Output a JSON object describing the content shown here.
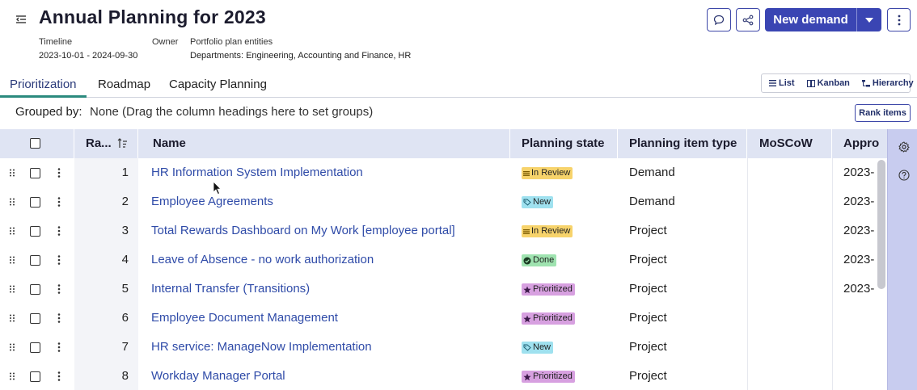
{
  "header": {
    "title": "Annual Planning for 2023",
    "timeline_label": "Timeline",
    "timeline_value": "2023-10-01 - 2024-09-30",
    "owner_label": "Owner",
    "entities_label": "Portfolio plan entities",
    "entities_value": "Departments: Engineering, Accounting and Finance, HR",
    "new_demand_label": "New demand",
    "icons": [
      "collapse-icon",
      "comment-icon",
      "share-icon",
      "chevron-down-icon",
      "more-vertical-icon"
    ]
  },
  "tabs": [
    {
      "label": "Prioritization",
      "active": true
    },
    {
      "label": "Roadmap",
      "active": false
    },
    {
      "label": "Capacity Planning",
      "active": false
    }
  ],
  "view_switch": {
    "list": "List",
    "kanban": "Kanban",
    "hierarchy": "Hierarchy"
  },
  "grouping": {
    "label": "Grouped by:",
    "value": "None (Drag the column headings here to set groups)",
    "rank_button": "Rank items"
  },
  "columns": {
    "rank": "Ra...",
    "name": "Name",
    "planning_state": "Planning state",
    "item_type": "Planning item type",
    "moscow": "MoSCoW",
    "approval": "Appro"
  },
  "rows": [
    {
      "rank": "1",
      "name": "HR Information System Implementation",
      "state": "In Review",
      "type": "Demand",
      "approval": "2023-"
    },
    {
      "rank": "2",
      "name": "Employee Agreements",
      "state": "New",
      "type": "Demand",
      "approval": "2023-"
    },
    {
      "rank": "3",
      "name": "Total Rewards Dashboard on My Work [employee portal]",
      "state": "In Review",
      "type": "Project",
      "approval": "2023-"
    },
    {
      "rank": "4",
      "name": "Leave of Absence - no work authorization",
      "state": "Done",
      "type": "Project",
      "approval": "2023-"
    },
    {
      "rank": "5",
      "name": "Internal Transfer (Transitions)",
      "state": "Prioritized",
      "type": "Project",
      "approval": "2023-"
    },
    {
      "rank": "6",
      "name": "Employee Document Management",
      "state": "Prioritized",
      "type": "Project",
      "approval": ""
    },
    {
      "rank": "7",
      "name": "HR service: ManageNow Implementation",
      "state": "New",
      "type": "Project",
      "approval": ""
    },
    {
      "rank": "8",
      "name": "Workday Manager Portal",
      "state": "Prioritized",
      "type": "Project",
      "approval": ""
    }
  ],
  "state_colors": {
    "In Review": "#f7d36b",
    "New": "#9fe1ef",
    "Done": "#9fe3b0",
    "Prioritized": "#d7a0e0"
  },
  "rail": {
    "icons": [
      "settings-icon",
      "help-icon"
    ]
  },
  "accent_color": "#3a45b3"
}
